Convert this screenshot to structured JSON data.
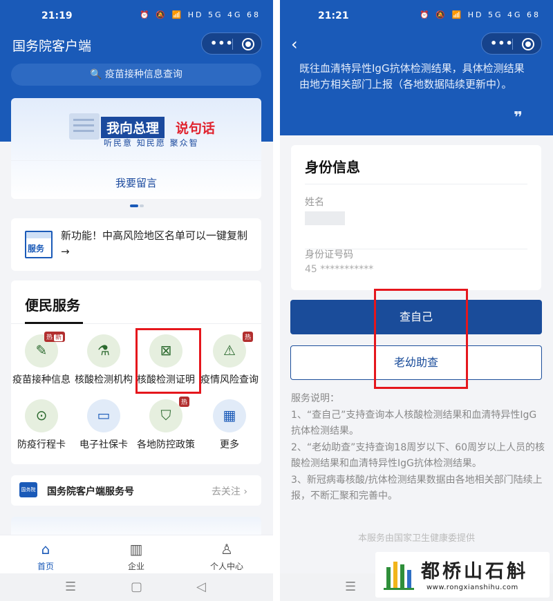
{
  "left": {
    "status_time": "21:19",
    "status_icons": "⏰ 🔕 📶 HD 5G 4G 68",
    "app_title": "国务院客户端",
    "capsule_more": "•••",
    "search_text": "🔍 疫苗接种信息查询",
    "banner": {
      "heading_part1": "我向总理",
      "heading_part2": "说句话",
      "subtitle": "听民意  知民愿  聚众智",
      "action": "我要留言"
    },
    "notice": {
      "icon_label": "服务",
      "text": "新功能！中高风险地区名单可以一键复制→"
    },
    "services": {
      "title": "便民服务",
      "items": [
        {
          "label": "疫苗接种信息",
          "badge": "热",
          "badge_new": "新",
          "icon": "vaccine-record-icon",
          "glyph": "✎"
        },
        {
          "label": "核酸检测机构",
          "badge": "",
          "badge_new": "",
          "icon": "test-tube-icon",
          "glyph": "⚗"
        },
        {
          "label": "核酸检测证明",
          "badge": "",
          "badge_new": "",
          "icon": "certificate-icon",
          "glyph": "⊠"
        },
        {
          "label": "疫情风险查询",
          "badge": "热",
          "badge_new": "",
          "icon": "warning-icon",
          "glyph": "⚠"
        },
        {
          "label": "防疫行程卡",
          "badge": "",
          "badge_new": "",
          "icon": "location-pin-icon",
          "glyph": "⊙"
        },
        {
          "label": "电子社保卡",
          "badge": "",
          "badge_new": "",
          "icon": "id-card-icon",
          "glyph": "▭"
        },
        {
          "label": "各地防控政策",
          "badge": "热",
          "badge_new": "",
          "icon": "shield-icon",
          "glyph": "⛉"
        },
        {
          "label": "更多",
          "badge": "",
          "badge_new": "",
          "icon": "grid-more-icon",
          "glyph": "▦"
        }
      ]
    },
    "follow": {
      "logo_text": "国务院",
      "name": "国务院客户端服务号",
      "action": "去关注 ›"
    },
    "tabs": [
      {
        "label": "首页",
        "icon": "home-icon",
        "glyph": "⌂"
      },
      {
        "label": "企业",
        "icon": "building-icon",
        "glyph": "▥"
      },
      {
        "label": "个人中心",
        "icon": "person-icon",
        "glyph": "♙"
      }
    ],
    "sysnav": {
      "menu": "☰",
      "home": "▢",
      "back": "◁"
    }
  },
  "right": {
    "status_time": "21:21",
    "status_icons": "⏰ 🔕 📶 HD 5G 4G 68",
    "back_icon": "‹",
    "capsule_more": "•••",
    "intro_text": "既往血清特异性IgG抗体检测结果，具体检测结果由地方相关部门上报（各地数据陆续更新中）。",
    "quote_mark": "❞",
    "identity": {
      "heading": "身份信息",
      "name_label": "姓名",
      "id_label": "身份证号码",
      "id_value": "45 ***********"
    },
    "buttons": {
      "self_check": "查自己",
      "family_check": "老幼助查"
    },
    "description": {
      "title": "服务说明：",
      "items": [
        "1、“查自己”支持查询本人核酸检测结果和血清特异性IgG抗体检测结果。",
        "2、“老幼助查”支持查询18周岁以下、60周岁以上人员的核酸检测结果和血清特异性IgG抗体检测结果。",
        "3、新冠病毒核酸/抗体检测结果数据由各地相关部门陆续上报，不断汇聚和完善中。"
      ]
    },
    "provided_by": "本服务由国家卫生健康委提供",
    "sysnav": {
      "menu": "☰"
    }
  },
  "watermark": {
    "name": "都桥山石斛",
    "url": "www.rongxianshihu.com"
  },
  "colors": {
    "brand_blue": "#1a5ab8",
    "button_blue": "#1a4c9a",
    "highlight_red": "#e5161c",
    "hot_badge": "#b22f2f"
  }
}
